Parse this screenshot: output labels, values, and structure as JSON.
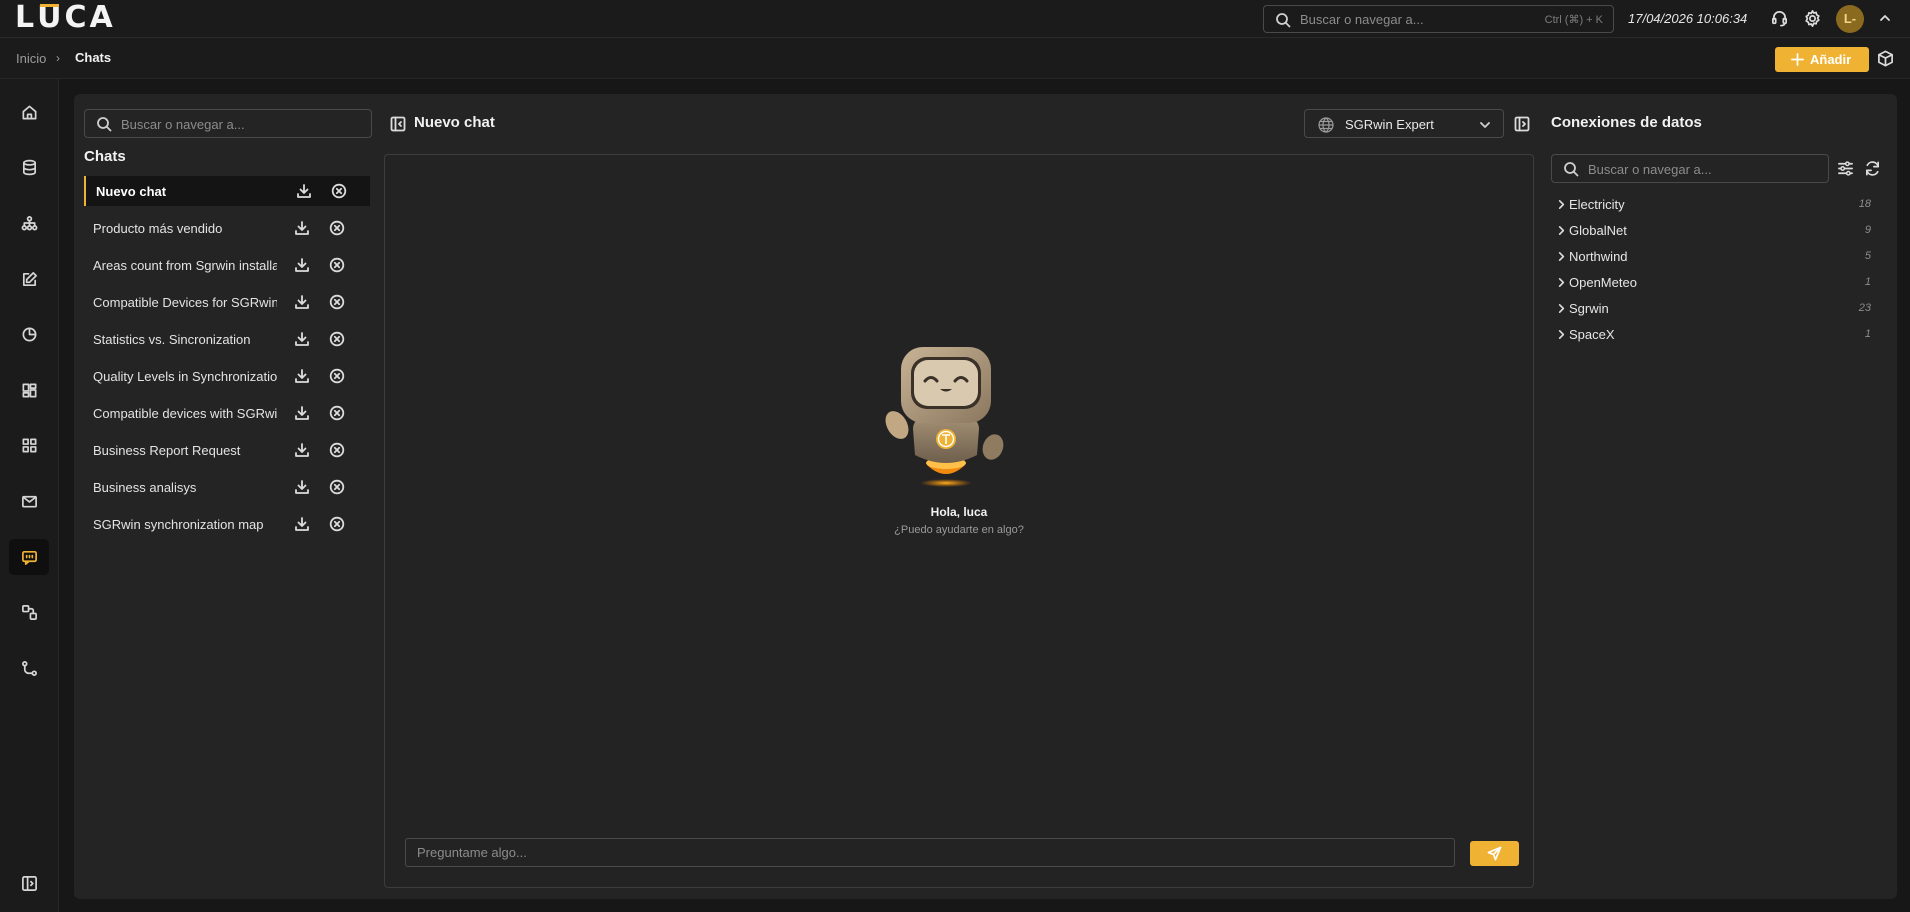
{
  "app": {
    "logo": "LUCA",
    "logo_before": "L",
    "logo_accent": "U",
    "logo_after": "CA"
  },
  "topbar": {
    "search_placeholder": "Buscar o navegar a...",
    "search_shortcut": "Ctrl (⌘) + K",
    "datetime": "17/04/2026 10:06:34",
    "user_initials": "L-"
  },
  "breadcrumb": {
    "home": "Inicio",
    "separator": "›",
    "current": "Chats"
  },
  "toolbar": {
    "add_label": "Añadir"
  },
  "chats_panel": {
    "search_placeholder": "Buscar o navegar a...",
    "title": "Chats",
    "items": [
      {
        "label": "Nuevo chat",
        "active": true
      },
      {
        "label": "Producto más vendido"
      },
      {
        "label": "Areas count from Sgrwin installation"
      },
      {
        "label": "Compatible Devices for SGRwin"
      },
      {
        "label": "Statistics vs. Sincronization"
      },
      {
        "label": "Quality Levels in Synchronization"
      },
      {
        "label": "Compatible devices with SGRwin"
      },
      {
        "label": "Business Report Request"
      },
      {
        "label": "Business analisys"
      },
      {
        "label": "SGRwin synchronization map"
      }
    ]
  },
  "chat": {
    "title": "Nuevo chat",
    "model": "SGRwin Expert",
    "greeting": "Hola, luca",
    "greeting_sub": "¿Puedo ayudarte en algo?",
    "input_placeholder": "Preguntame algo..."
  },
  "data_connections": {
    "title": "Conexiones de datos",
    "search_placeholder": "Buscar o navegar a...",
    "items": [
      {
        "name": "Electricity",
        "count": "18"
      },
      {
        "name": "GlobalNet",
        "count": "9"
      },
      {
        "name": "Northwind",
        "count": "5"
      },
      {
        "name": "OpenMeteo",
        "count": "1"
      },
      {
        "name": "Sgrwin",
        "count": "23"
      },
      {
        "name": "SpaceX",
        "count": "1"
      }
    ]
  },
  "nav": [
    {
      "name": "home-icon"
    },
    {
      "name": "database-icon"
    },
    {
      "name": "hierarchy-icon"
    },
    {
      "name": "edit-icon"
    },
    {
      "name": "pie-chart-icon"
    },
    {
      "name": "dashboard-icon"
    },
    {
      "name": "grid-icon"
    },
    {
      "name": "mail-icon"
    },
    {
      "name": "chat-icon",
      "active": true
    },
    {
      "name": "workflow-icon"
    },
    {
      "name": "git-branch-icon"
    }
  ],
  "colors": {
    "accent": "#f0b232",
    "background": "#171717",
    "panel": "#242424"
  }
}
